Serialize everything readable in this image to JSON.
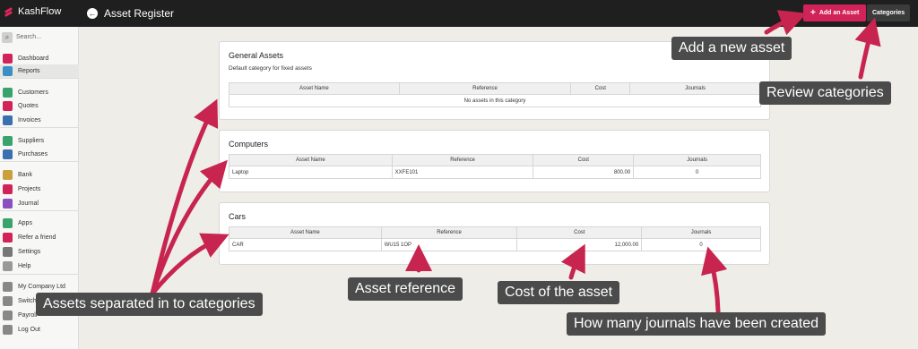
{
  "topbar": {
    "brand": "KashFlow",
    "title": "Asset Register",
    "add_button": "Add an Asset",
    "categories_button": "Categories"
  },
  "sidebar": {
    "search_placeholder": "Search...",
    "items": [
      {
        "label": "Dashboard",
        "icon": "dashboard-icon",
        "color": "#d1235a"
      },
      {
        "label": "Reports",
        "icon": "reports-icon",
        "color": "#3a8fc7"
      },
      {
        "label": "Customers",
        "icon": "customers-icon",
        "color": "#3aa36b"
      },
      {
        "label": "Quotes",
        "icon": "quotes-icon",
        "color": "#d1235a"
      },
      {
        "label": "Invoices",
        "icon": "invoices-icon",
        "color": "#3a6fb0"
      },
      {
        "label": "Suppliers",
        "icon": "suppliers-icon",
        "color": "#3aa36b"
      },
      {
        "label": "Purchases",
        "icon": "purchases-icon",
        "color": "#3a6fb0"
      },
      {
        "label": "Bank",
        "icon": "bank-icon",
        "color": "#c9a13a"
      },
      {
        "label": "Projects",
        "icon": "projects-icon",
        "color": "#d1235a"
      },
      {
        "label": "Journal",
        "icon": "journal-icon",
        "color": "#8a4fc0"
      },
      {
        "label": "Apps",
        "icon": "apps-icon",
        "color": "#3aa36b"
      },
      {
        "label": "Refer a friend",
        "icon": "heart-icon",
        "color": "#d1235a"
      },
      {
        "label": "Settings",
        "icon": "gear-icon",
        "color": "#777777"
      },
      {
        "label": "Help",
        "icon": "help-icon",
        "color": "#999999"
      },
      {
        "label": "My Company Ltd",
        "icon": "company-icon",
        "color": "#888888"
      },
      {
        "label": "Switch",
        "icon": "switch-icon",
        "color": "#888888"
      },
      {
        "label": "Payroll",
        "icon": "payroll-icon",
        "color": "#888888"
      },
      {
        "label": "Log Out",
        "icon": "power-icon",
        "color": "#888888"
      }
    ]
  },
  "columns": [
    "Asset Name",
    "Reference",
    "Cost",
    "Journals"
  ],
  "categories": [
    {
      "title": "General Assets",
      "subtitle": "Default category for fixed assets",
      "empty_message": "No assets in this category"
    },
    {
      "title": "Computers",
      "rows": [
        {
          "name": "Laptop",
          "reference": "XXFE101",
          "cost": "800.00",
          "journals": "0"
        }
      ]
    },
    {
      "title": "Cars",
      "rows": [
        {
          "name": "CAR",
          "reference": "WU15 1OP",
          "cost": "12,000.00",
          "journals": "0"
        }
      ]
    }
  ],
  "callouts": {
    "add_asset": "Add a new asset",
    "review_categories": "Review categories",
    "categories_sep": "Assets separated in to categories",
    "reference": "Asset reference",
    "cost": "Cost of the asset",
    "journals": "How many journals have been created"
  },
  "colors": {
    "accent": "#d1235a",
    "topbar": "#1f1f1f",
    "callout_bg": "#4b4b4b"
  }
}
